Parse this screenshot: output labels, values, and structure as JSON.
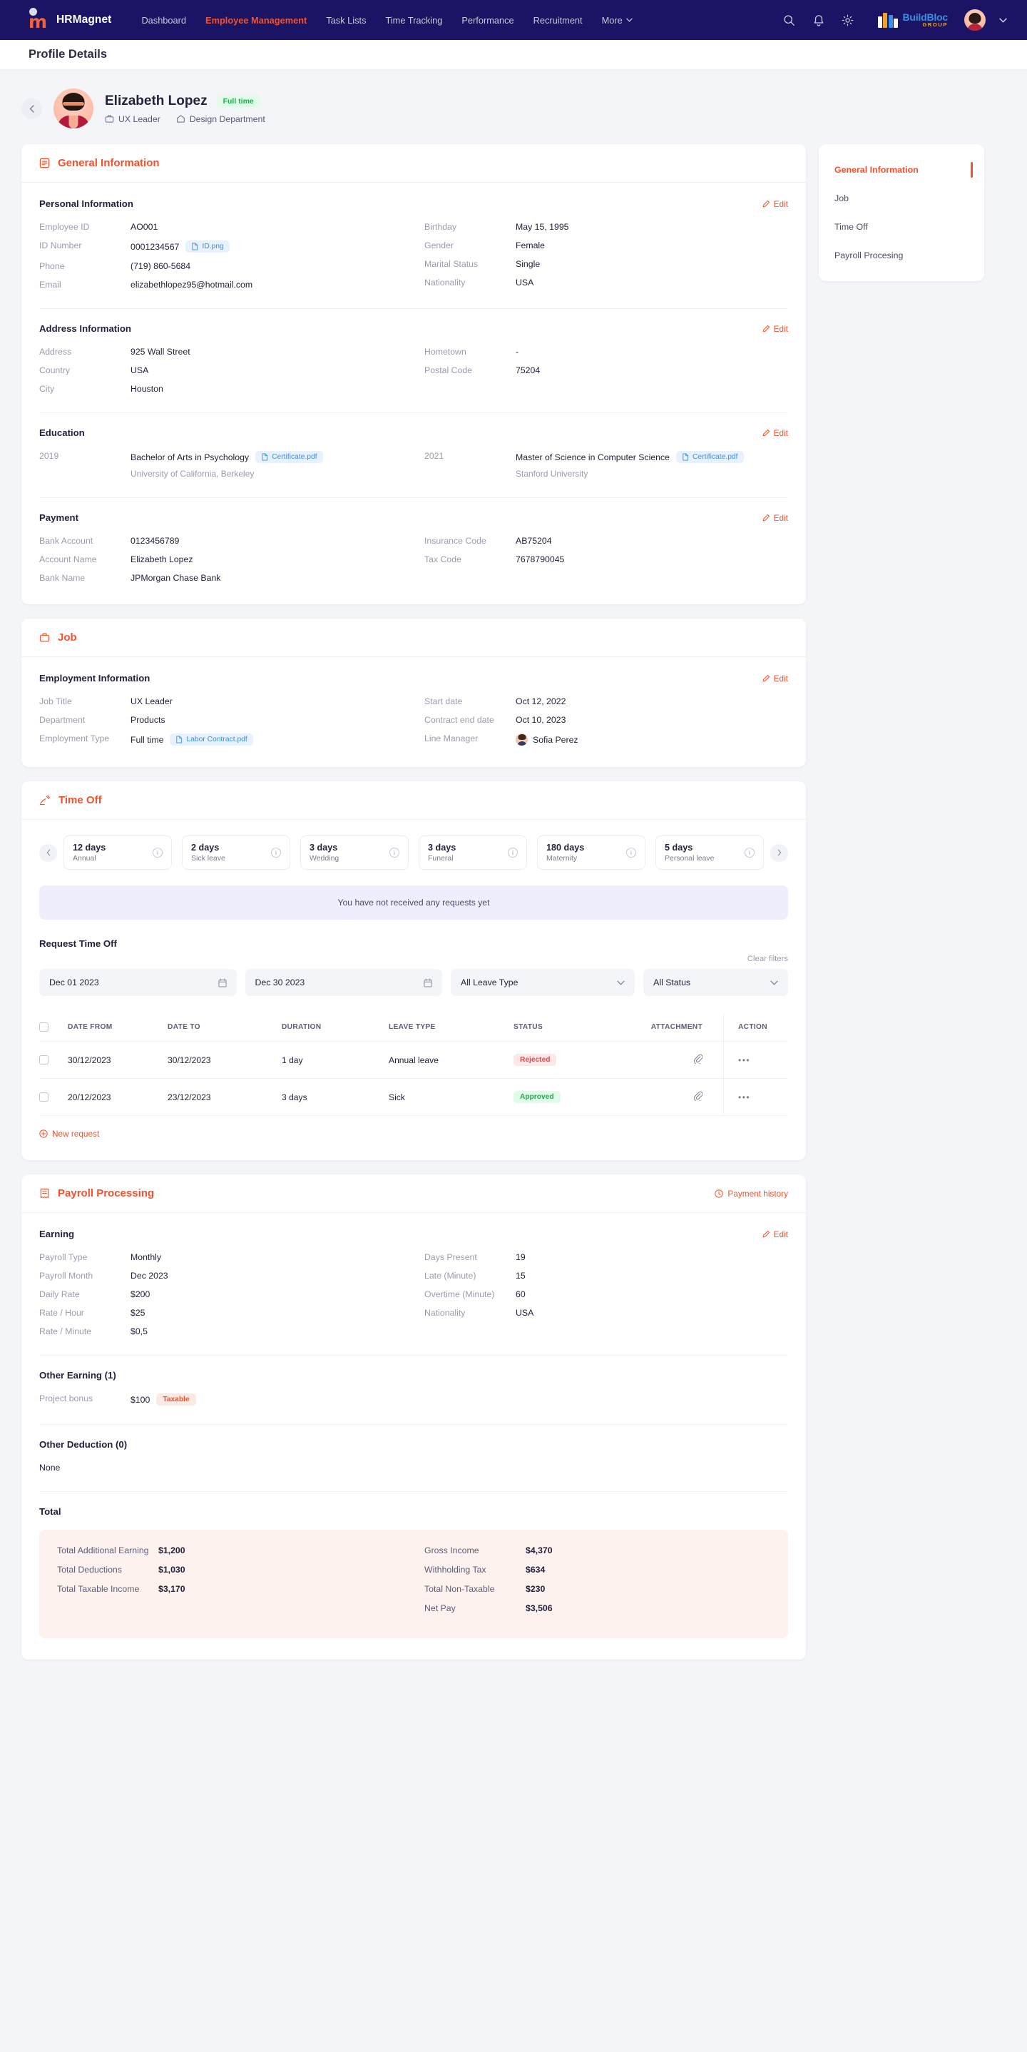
{
  "navbar": {
    "brand": "HRMagnet",
    "links": [
      {
        "label": "Dashboard",
        "active": false
      },
      {
        "label": "Employee Management",
        "active": true
      },
      {
        "label": "Task Lists",
        "active": false
      },
      {
        "label": "Time Tracking",
        "active": false
      },
      {
        "label": "Performance",
        "active": false
      },
      {
        "label": "Recruitment",
        "active": false
      }
    ],
    "more_label": "More",
    "icons": [
      "search-icon",
      "bell-icon",
      "gear-icon"
    ],
    "company": {
      "title": "BuildBloc",
      "subtitle": "GROUP"
    }
  },
  "page": {
    "title": "Profile Details"
  },
  "profile": {
    "name": "Elizabeth Lopez",
    "badge": "Full time",
    "job_title": "UX Leader",
    "department": "Design Department"
  },
  "general": {
    "section_title": "General Information",
    "personal": {
      "title": "Personal Information",
      "edit": "Edit",
      "left": [
        {
          "label": "Employee ID",
          "value": "AO001"
        },
        {
          "label": "ID Number",
          "value": "0001234567",
          "file": "ID.png"
        },
        {
          "label": "Phone",
          "value": "(719) 860-5684"
        },
        {
          "label": "Email",
          "value": "elizabethlopez95@hotmail.com"
        }
      ],
      "right": [
        {
          "label": "Birthday",
          "value": "May 15, 1995"
        },
        {
          "label": "Gender",
          "value": "Female"
        },
        {
          "label": "Marital Status",
          "value": "Single"
        },
        {
          "label": "Nationality",
          "value": "USA"
        }
      ]
    },
    "address": {
      "title": "Address Information",
      "edit": "Edit",
      "left": [
        {
          "label": "Address",
          "value": "925 Wall Street"
        },
        {
          "label": "Country",
          "value": "USA"
        },
        {
          "label": "City",
          "value": "Houston"
        }
      ],
      "right": [
        {
          "label": "Hometown",
          "value": "-"
        },
        {
          "label": "Postal Code",
          "value": "75204"
        }
      ]
    },
    "education": {
      "title": "Education",
      "edit": "Edit",
      "items": [
        {
          "year": "2019",
          "degree": "Bachelor of Arts in Psychology",
          "file": "Certificate.pdf",
          "school": "University of California, Berkeley"
        },
        {
          "year": "2021",
          "degree": "Master of Science in Computer Science",
          "file": "Certificate.pdf",
          "school": "Stanford University"
        }
      ]
    },
    "payment": {
      "title": "Payment",
      "edit": "Edit",
      "left": [
        {
          "label": "Bank Account",
          "value": "0123456789"
        },
        {
          "label": "Account Name",
          "value": "Elizabeth Lopez"
        },
        {
          "label": "Bank Name",
          "value": "JPMorgan Chase Bank"
        }
      ],
      "right": [
        {
          "label": "Insurance Code",
          "value": "AB75204"
        },
        {
          "label": "Tax Code",
          "value": "7678790045"
        }
      ]
    }
  },
  "job": {
    "section_title": "Job",
    "employment": {
      "title": "Employment Information",
      "edit": "Edit",
      "left": [
        {
          "label": "Job Title",
          "value": "UX Leader"
        },
        {
          "label": "Department",
          "value": "Products"
        },
        {
          "label": "Employment Type",
          "value": "Full time",
          "file": "Labor Contract.pdf"
        }
      ],
      "right": [
        {
          "label": "Start date",
          "value": "Oct 12, 2022"
        },
        {
          "label": "Contract end date",
          "value": "Oct 10, 2023"
        },
        {
          "label": "Line  Manager",
          "value": "Sofia Perez",
          "avatar": true
        }
      ]
    }
  },
  "timeoff": {
    "section_title": "Time Off",
    "balances": [
      {
        "days": "12 days",
        "type": "Annual"
      },
      {
        "days": "2 days",
        "type": "Sick leave"
      },
      {
        "days": "3 days",
        "type": "Wedding"
      },
      {
        "days": "3 days",
        "type": "Funeral"
      },
      {
        "days": "180 days",
        "type": "Maternity"
      },
      {
        "days": "5 days",
        "type": "Personal leave"
      }
    ],
    "empty_banner": "You have not received any requests yet",
    "request_title": "Request Time Off",
    "clear_filters": "Clear filters",
    "filters": {
      "date_from": "Dec 01  2023",
      "date_to": "Dec 30 2023",
      "leave_type": "All Leave Type",
      "status": "All Status"
    },
    "table": {
      "columns": [
        "DATE FROM",
        "DATE TO",
        "DURATION",
        "LEAVE TYPE",
        "STATUS",
        "ATTACHMENT",
        "ACTION"
      ],
      "rows": [
        {
          "date_from": "30/12/2023",
          "date_to": "30/12/2023",
          "duration": "1 day",
          "leave_type": "Annual leave",
          "status": "Rejected",
          "status_kind": "rejected"
        },
        {
          "date_from": "20/12/2023",
          "date_to": "23/12/2023",
          "duration": "3 days",
          "leave_type": "Sick",
          "status": "Approved",
          "status_kind": "approved"
        }
      ]
    },
    "new_request": "New request"
  },
  "payroll": {
    "section_title": "Payroll Processing",
    "payment_history": "Payment history",
    "earning": {
      "title": "Earning",
      "edit": "Edit",
      "left": [
        {
          "label": "Payroll Type",
          "value": "Monthly"
        },
        {
          "label": "Payroll Month",
          "value": "Dec 2023"
        },
        {
          "label": "Daily Rate",
          "value": "$200"
        },
        {
          "label": "Rate / Hour",
          "value": "$25"
        },
        {
          "label": "Rate / Minute",
          "value": "$0,5"
        }
      ],
      "right": [
        {
          "label": "Days Present",
          "value": "19"
        },
        {
          "label": "Late (Minute)",
          "value": "15"
        },
        {
          "label": "Overtime (Minute)",
          "value": "60"
        },
        {
          "label": "Nationality",
          "value": "USA"
        }
      ]
    },
    "other_earning": {
      "title": "Other Earning (1)",
      "items": [
        {
          "label": "Project bonus",
          "value": "$100",
          "tag": "Taxable"
        }
      ]
    },
    "other_deduction": {
      "title": "Other Deduction (0)",
      "empty": "None"
    },
    "total": {
      "title": "Total",
      "left": [
        {
          "label": "Total Additional Earning",
          "value": "$1,200"
        },
        {
          "label": "Total Deductions",
          "value": "$1,030"
        },
        {
          "label": "Total Taxable Income",
          "value": "$3,170"
        }
      ],
      "right": [
        {
          "label": "Gross Income",
          "value": "$4,370"
        },
        {
          "label": "Withholding Tax",
          "value": "$634"
        },
        {
          "label": "Total Non-Taxable",
          "value": "$230"
        },
        {
          "label": "Net Pay",
          "value": "$3,506"
        }
      ]
    }
  },
  "sidenav": {
    "items": [
      {
        "label": "General Information",
        "active": true
      },
      {
        "label": "Job",
        "active": false
      },
      {
        "label": "Time Off",
        "active": false
      },
      {
        "label": "Payroll Procesing",
        "active": false
      }
    ]
  },
  "colors": {
    "accent": "#f4512c",
    "navbar": "#1b1464",
    "approved": "#19b04b",
    "rejected": "#e14747"
  }
}
